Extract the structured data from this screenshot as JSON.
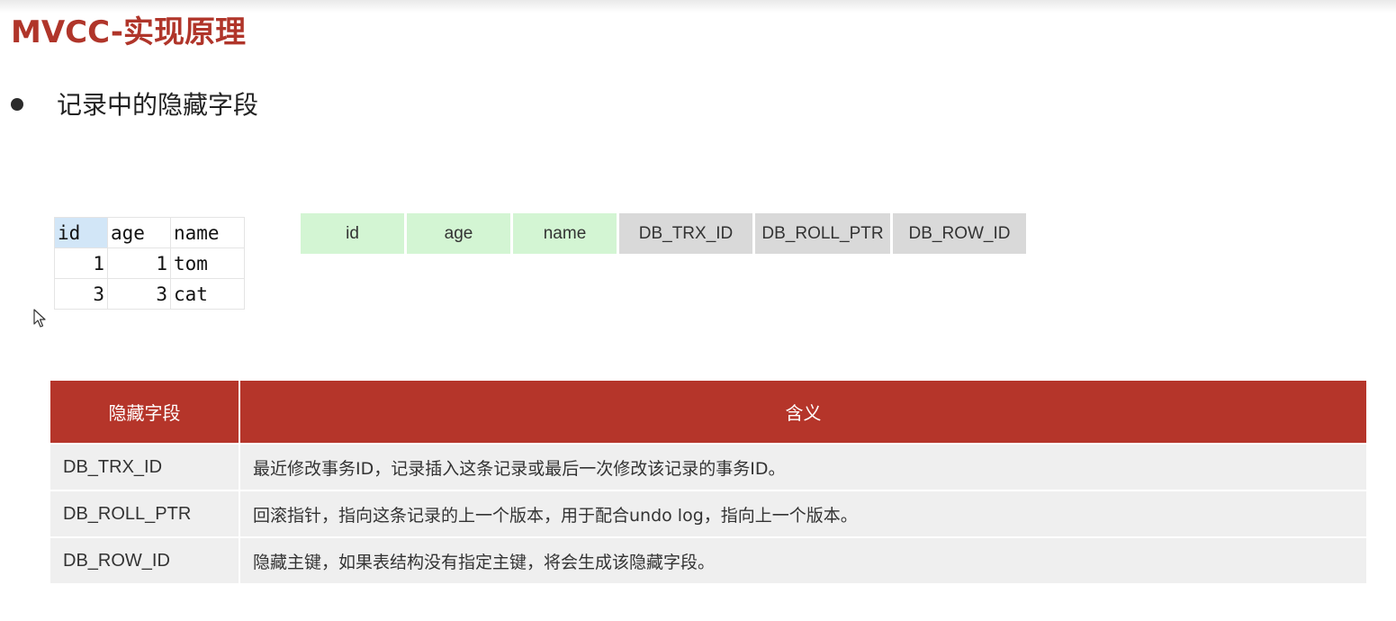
{
  "title": "MVCC-实现原理",
  "bullet": "记录中的隐藏字段",
  "sample_table": {
    "headers": [
      "id",
      "age",
      "name"
    ],
    "rows": [
      [
        "1",
        "1",
        "tom"
      ],
      [
        "3",
        "3",
        "cat"
      ]
    ]
  },
  "fields": {
    "user": [
      "id",
      "age",
      "name"
    ],
    "hidden": [
      "DB_TRX_ID",
      "DB_ROLL_PTR",
      "DB_ROW_ID"
    ]
  },
  "hidden_table": {
    "headers": [
      "隐藏字段",
      "含义"
    ],
    "rows": [
      [
        "DB_TRX_ID",
        "最近修改事务ID，记录插入这条记录或最后一次修改该记录的事务ID。"
      ],
      [
        "DB_ROLL_PTR",
        "回滚指针，指向这条记录的上一个版本，用于配合undo log，指向上一个版本。"
      ],
      [
        "DB_ROW_ID",
        "隐藏主键，如果表结构没有指定主键，将会生成该隐藏字段。"
      ]
    ]
  },
  "colors": {
    "accent": "#b5352a",
    "user_field_bg": "#d3f5d3",
    "hidden_field_bg": "#d9d9d9"
  },
  "icons": [
    "mouse-cursor-icon"
  ]
}
